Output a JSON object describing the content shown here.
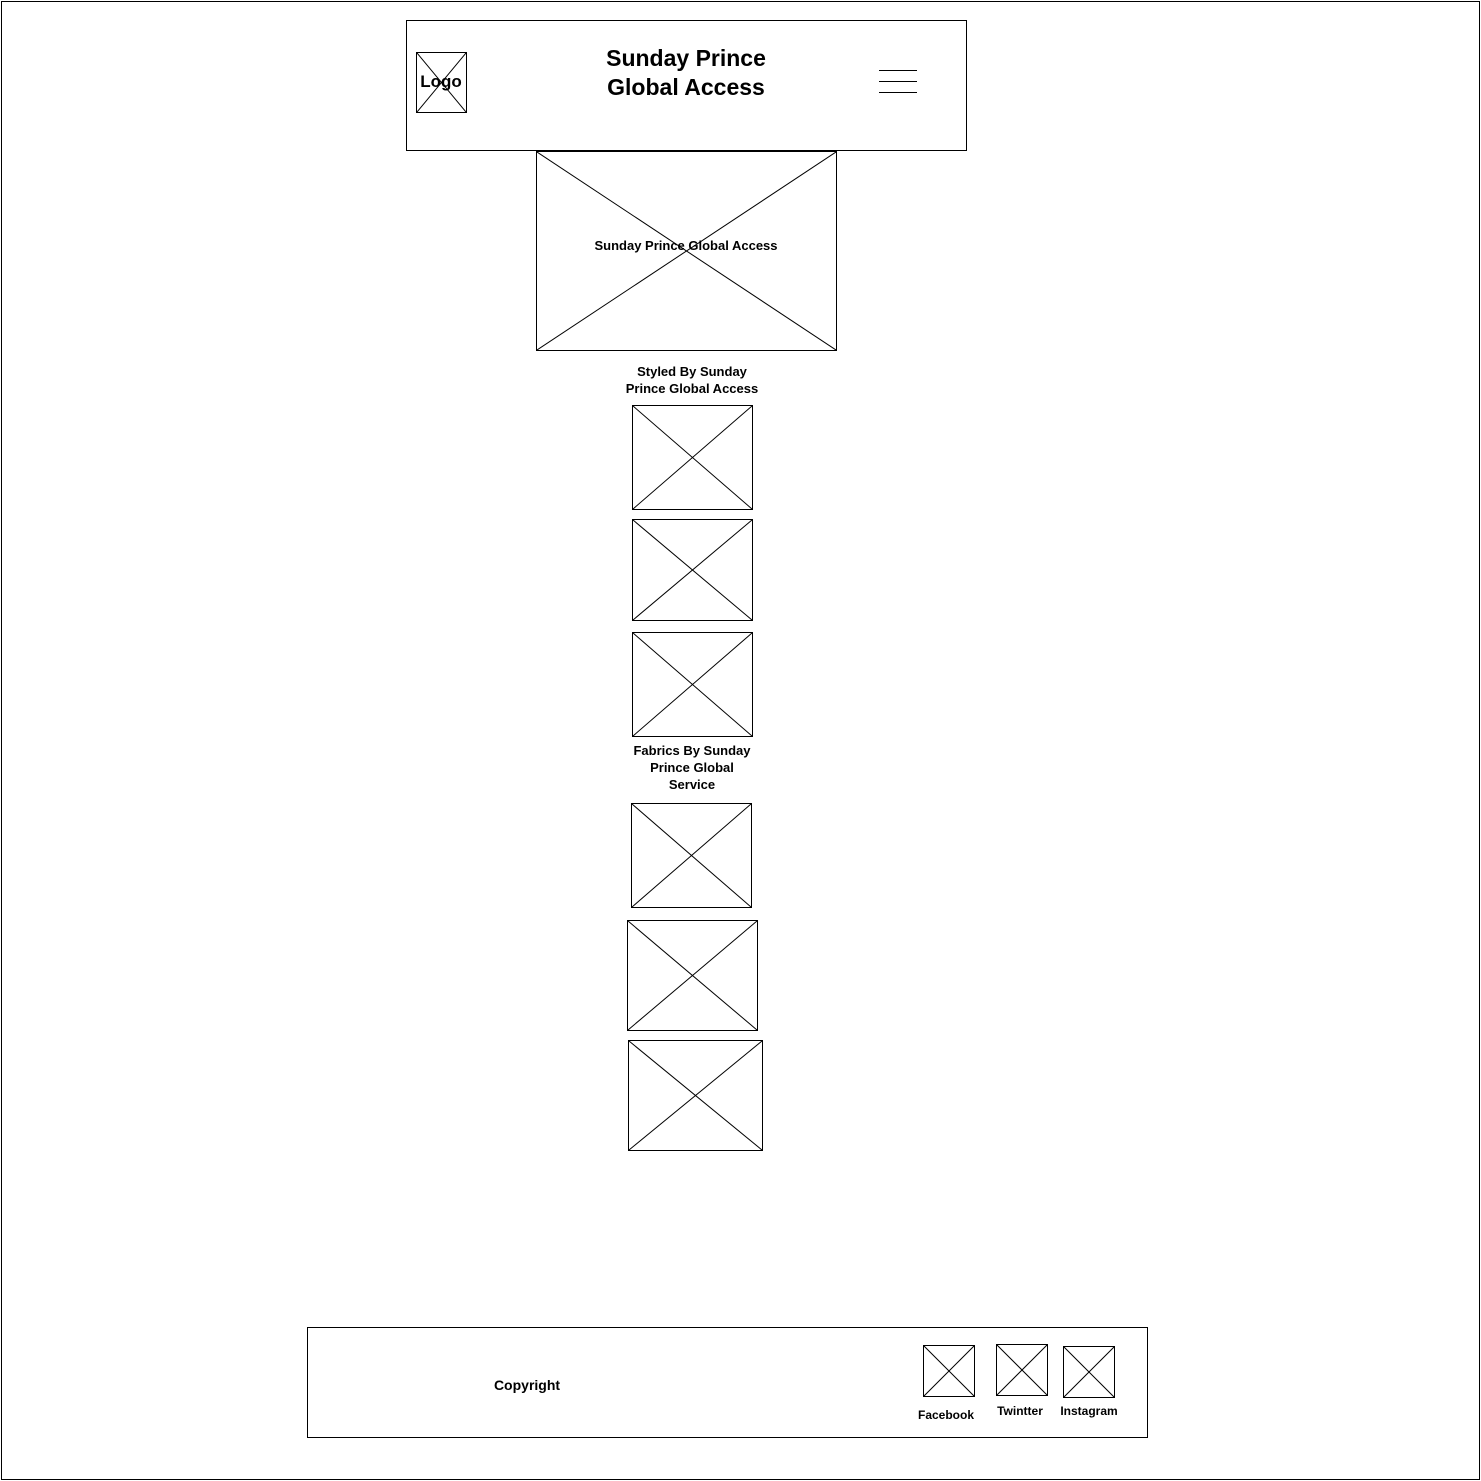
{
  "header": {
    "logo_label": "Logo",
    "title_line1": "Sunday Prince",
    "title_line2": "Global Access"
  },
  "hero": {
    "label": "Sunday Prince Global Access"
  },
  "sections": {
    "styled_heading_line1": "Styled By Sunday",
    "styled_heading_line2": "Prince Global Access",
    "fabrics_heading_line1": "Fabrics By Sunday",
    "fabrics_heading_line2": "Prince Global",
    "fabrics_heading_line3": "Service"
  },
  "footer": {
    "copyright": "Copyright",
    "social": [
      {
        "label": "Facebook",
        "icon": "facebook-icon"
      },
      {
        "label": "Twintter",
        "icon": "twitter-icon"
      },
      {
        "label": "Instagram",
        "icon": "instagram-icon"
      }
    ]
  }
}
